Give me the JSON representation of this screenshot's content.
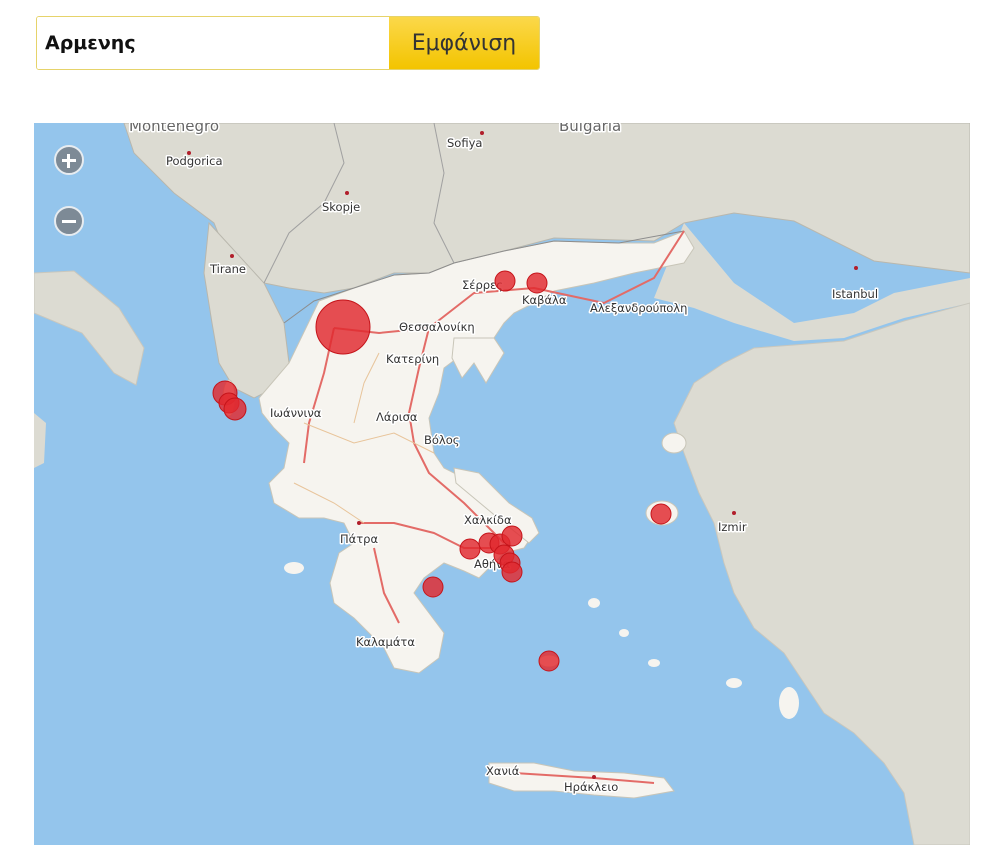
{
  "search": {
    "value": "Αρμενης",
    "button_label": "Εμφάνιση"
  },
  "map": {
    "colors": {
      "sea": "#94c5ec",
      "land": "#f6f4ef",
      "neighbor": "#dcdbd2",
      "road": "#e36b67",
      "marker": "#e0282e"
    },
    "zoom": {
      "in_icon": "plus-icon",
      "out_icon": "minus-icon"
    },
    "labels": {
      "montenegro": "Montenegro",
      "bulgaria": "Bulgaria",
      "podgorica": "Podgorica",
      "sofiya": "Sofiya",
      "skopje": "Skopje",
      "tirane": "Tirane",
      "serres": "Σέρρες",
      "kavala": "Καβάλα",
      "alexandroupoli": "Αλεξανδρούπολη",
      "istanbul": "Istanbul",
      "thessaloniki": "Θεσσαλονίκη",
      "katerini": "Κατερίνη",
      "ioannina": "Ιωάννινα",
      "larisa": "Λάρισα",
      "volos": "Βόλος",
      "chalkida": "Χαλκίδα",
      "izmir": "Izmir",
      "patra": "Πάτρα",
      "athina": "Αθήνα",
      "kalamata": "Καλαμάτα",
      "chania": "Χανιά",
      "irakleio": "Ηράκλειο"
    },
    "markers": [
      {
        "name": "Florina",
        "magnitude": "large"
      },
      {
        "name": "Serres",
        "magnitude": "small"
      },
      {
        "name": "Kavala",
        "magnitude": "small"
      },
      {
        "name": "Corfu",
        "magnitude": "medium"
      },
      {
        "name": "Corfu south",
        "magnitude": "small"
      },
      {
        "name": "Lesvos",
        "magnitude": "small"
      },
      {
        "name": "Athens",
        "magnitude": "small"
      },
      {
        "name": "Argolida",
        "magnitude": "small"
      },
      {
        "name": "Milos",
        "magnitude": "small"
      }
    ]
  }
}
